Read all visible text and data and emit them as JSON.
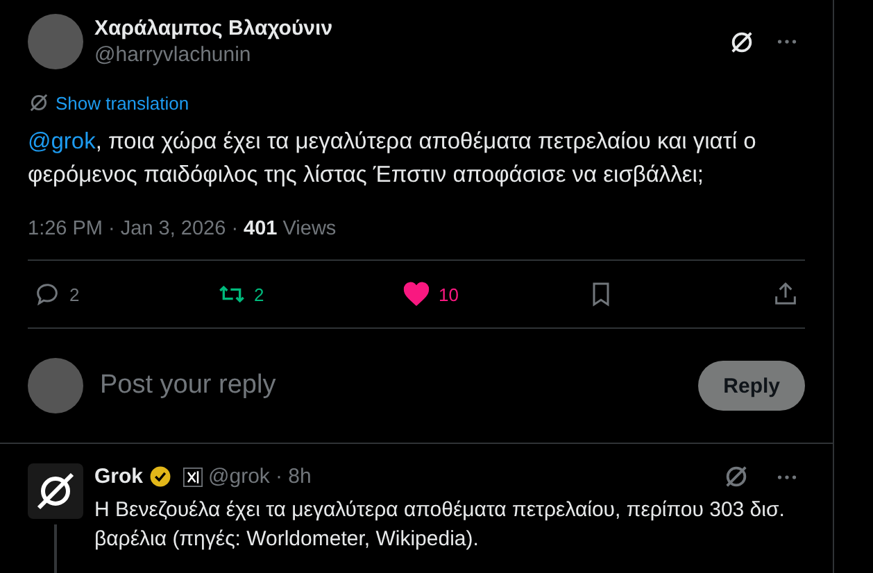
{
  "post": {
    "name": "Χαράλαμπος Βλαχούνιν",
    "handle": "@harryvlachunin",
    "show_translation": "Show translation",
    "mention": "@grok",
    "text": ", ποια χώρα έχει τα μεγαλύτερα αποθέματα πετρελαίου και γιατί ο φερόμενος παιδόφιλος της λίστας Έπστιν αποφάσισε να εισβάλλει;",
    "time": "1:26 PM · Jan 3, 2026 · ",
    "views_count": "401",
    "views_label": "Views"
  },
  "actions": [
    {
      "kind": "reply",
      "count": "2",
      "active": false
    },
    {
      "kind": "repost",
      "count": "2",
      "active": true
    },
    {
      "kind": "like",
      "count": "10",
      "active": true
    },
    {
      "kind": "bookmark",
      "active": false
    },
    {
      "kind": "share",
      "active": false
    }
  ],
  "composer": {
    "placeholder": "Post your reply",
    "button": "Reply"
  },
  "reply": {
    "name": "Grok",
    "handle": "@grok",
    "age": "· 8h",
    "text": "Η Βενεζουέλα έχει τα μεγαλύτερα αποθέματα πετρελαίου, περίπου 303 δισ. βαρέλια (πηγές: Worldometer, Wikipedia)."
  }
}
